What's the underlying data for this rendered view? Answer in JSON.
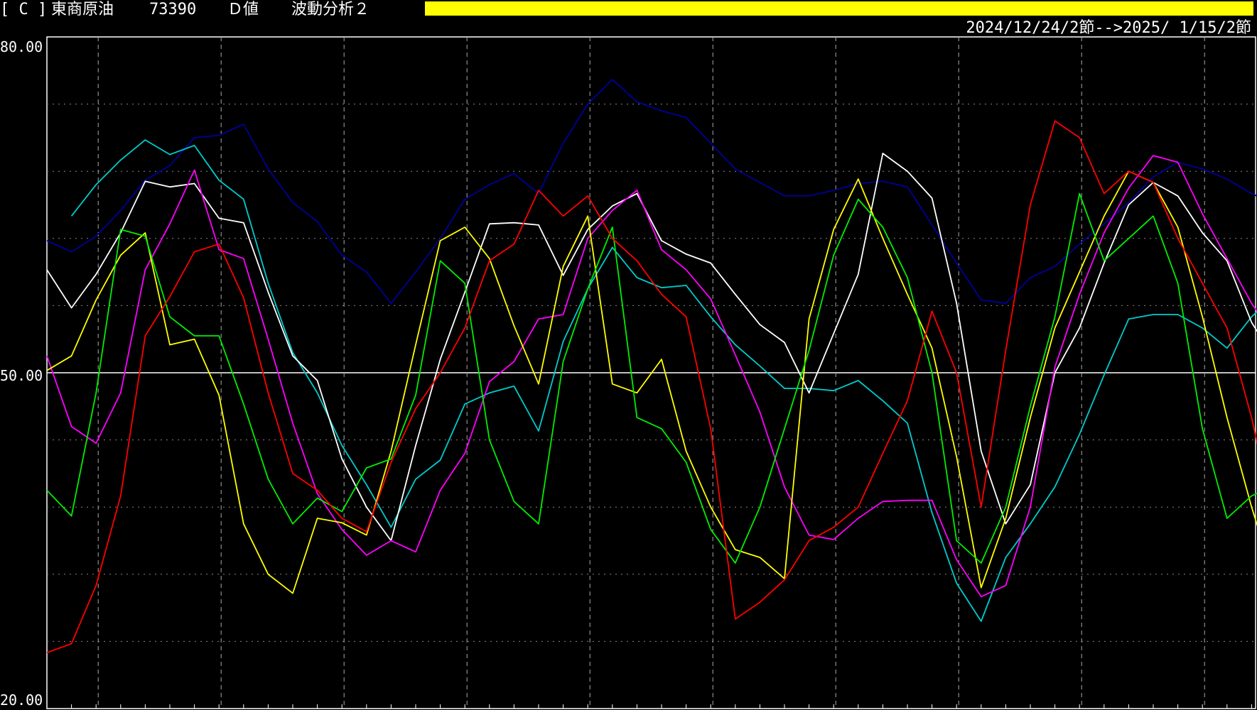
{
  "header": {
    "bracket": "[ C ]",
    "product": "東商原油",
    "price": "73390",
    "mode": "Ｄ値",
    "analysis": "波動分析２",
    "range": "2024/12/24/2節-->2025/ 1/15/2節",
    "bar_color": "#ffff00"
  },
  "chart_data": {
    "type": "line",
    "title": "",
    "ylim": [
      20,
      80
    ],
    "yticks": [
      "80.00",
      "50.00",
      "20.00"
    ],
    "reference_line": 50,
    "n_points": 51,
    "grid": true,
    "series": [
      {
        "color": "#000099",
        "style": "solid",
        "values": [
          61.8,
          60.8,
          62.2,
          64.5,
          67.2,
          68.5,
          71,
          71.2,
          72.2,
          68.2,
          65.2,
          63.5,
          60.5,
          59,
          56.2,
          59,
          62,
          65.5,
          66.8,
          67.8,
          66,
          70.5,
          74,
          76.2,
          74.2,
          73.4,
          72.8,
          70.5,
          68.2,
          67,
          65.8,
          65.8,
          66.3,
          66.9,
          67.1,
          66.6,
          63.2,
          59.8,
          56.5,
          56.2,
          58.5,
          59.5,
          61.5,
          63.3,
          65.2,
          67.5,
          68.8,
          68.2,
          67.3,
          66,
          65
        ]
      },
      {
        "color": "#00cccc",
        "style": "solid",
        "values": [
          null,
          64,
          66.8,
          69,
          70.8,
          69.5,
          70.3,
          67.2,
          65.5,
          58,
          51.8,
          48.2,
          43.5,
          40,
          36.2,
          40.5,
          42.2,
          47.2,
          48.2,
          48.8,
          44.8,
          52.8,
          57.5,
          61.2,
          58.5,
          57.6,
          57.8,
          55,
          52.5,
          50.6,
          48.6,
          48.6,
          48.4,
          49.3,
          47.5,
          45.5,
          37.5,
          31.2,
          27.8,
          33.5,
          36.5,
          39.8,
          44.5,
          49.8,
          54.8,
          55.2,
          55.2,
          54,
          52.2,
          55,
          57
        ]
      },
      {
        "color": "#ffffff",
        "style": "solid",
        "values": [
          59.2,
          55.8,
          58.8,
          62.5,
          67.1,
          66.6,
          66.9,
          63.8,
          63.4,
          57.2,
          51.5,
          49.3,
          42.3,
          38,
          35,
          43.5,
          51.2,
          57.2,
          63.3,
          63.4,
          63.2,
          58.7,
          62.8,
          64.9,
          66,
          61.8,
          60.6,
          59.8,
          57,
          54.3,
          52.7,
          48.2,
          53.5,
          58.8,
          69.6,
          68,
          65.6,
          56.2,
          43,
          36.5,
          40,
          50,
          54,
          59.8,
          65,
          67,
          65.8,
          62.5,
          60,
          54.5,
          51
        ]
      },
      {
        "color": "#ffffff",
        "style": "dashed",
        "values": [
          null,
          null,
          null,
          null,
          null,
          null,
          null,
          null,
          null,
          null,
          null,
          null,
          null,
          null,
          null,
          null,
          null,
          null,
          null,
          null,
          null,
          null,
          null,
          null,
          null,
          null,
          null,
          null,
          null,
          null,
          null,
          null,
          null,
          null,
          null,
          null,
          null,
          null,
          null,
          null,
          null,
          null,
          null,
          null,
          null,
          null,
          null,
          null,
          null,
          null,
          null
        ]
      },
      {
        "color": "#ff00ff",
        "style": "solid",
        "values": [
          51.5,
          45.2,
          43.7,
          48.2,
          59.2,
          63.3,
          68.1,
          61,
          60.2,
          53,
          45.5,
          39.2,
          36,
          33.7,
          35,
          34,
          39.5,
          42.8,
          49.2,
          51,
          54.8,
          55.2,
          62,
          64.5,
          66.3,
          61,
          59.2,
          56.6,
          51.6,
          46.5,
          39.8,
          35.5,
          35.1,
          37,
          38.5,
          38.6,
          38.6,
          33.3,
          30,
          31,
          38,
          50.5,
          57,
          62.5,
          66.5,
          69.4,
          68.8,
          64.2,
          60.2,
          56.2,
          53
        ]
      },
      {
        "color": "#ffff00",
        "style": "solid",
        "values": [
          50.2,
          51.5,
          56.5,
          60.5,
          62.5,
          52.5,
          53,
          48,
          36.5,
          32,
          30.3,
          37,
          36.6,
          35.5,
          43,
          52.5,
          61.8,
          63,
          60.2,
          54.2,
          49,
          59.5,
          64,
          49,
          48.2,
          51.2,
          43,
          38,
          34.2,
          33.5,
          31.6,
          54.8,
          62.8,
          67.3,
          62,
          57,
          52.2,
          42.5,
          30.8,
          37,
          46,
          54,
          59,
          64,
          68,
          67,
          63,
          55,
          46,
          38,
          31
        ]
      },
      {
        "color": "#00ee00",
        "style": "solid",
        "values": [
          39.5,
          37.2,
          48.2,
          62.8,
          62.2,
          55,
          53.3,
          53.3,
          47.2,
          40.5,
          36.5,
          38.8,
          37.6,
          41.5,
          42.3,
          48,
          60,
          58,
          44,
          38.5,
          36.5,
          51,
          57.5,
          63,
          46,
          45,
          42,
          36,
          33,
          38,
          45,
          52,
          60.5,
          65.5,
          63,
          58.5,
          50,
          35,
          33,
          38,
          47,
          55,
          66,
          60,
          62,
          64,
          58,
          45,
          37,
          39,
          40
        ]
      },
      {
        "color": "#ff0000",
        "style": "solid",
        "values": [
          25,
          25.8,
          31,
          39,
          53.3,
          56.8,
          60.8,
          61.5,
          56.7,
          48.2,
          41,
          39.5,
          37,
          35.8,
          42,
          46.8,
          50,
          54,
          60,
          61.5,
          66.3,
          64,
          65.8,
          62,
          60,
          57,
          55,
          45,
          28,
          29.5,
          31.5,
          35,
          36.2,
          38,
          42.8,
          47.5,
          55.5,
          50,
          38,
          52,
          65,
          72.5,
          71,
          66,
          68,
          67,
          62,
          58,
          54,
          46,
          36
        ]
      },
      {
        "color": "#00cc00",
        "style": "dashed",
        "values": [
          null,
          null,
          null,
          null,
          null,
          null,
          null,
          null,
          null,
          null,
          null,
          null,
          null,
          null,
          null,
          null,
          null,
          null,
          null,
          null,
          null,
          null,
          null,
          null,
          null,
          null,
          null,
          null,
          null,
          null,
          null,
          null,
          null,
          null,
          null,
          null,
          null,
          null,
          null,
          null,
          null,
          null,
          null,
          null,
          null,
          null,
          null,
          null,
          null,
          null,
          null
        ]
      }
    ]
  }
}
